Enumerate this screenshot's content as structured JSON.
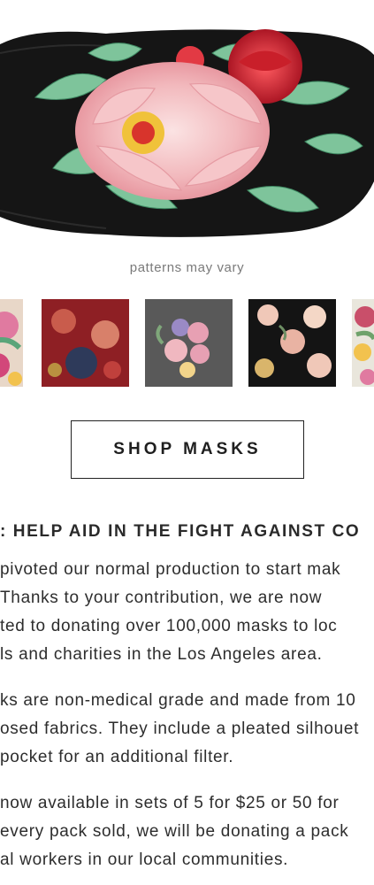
{
  "hero": {
    "image_name": "floral-peony-mask-image"
  },
  "caption": "patterns may vary",
  "pattern_swatches": [
    {
      "name": "pink-floral-swatch",
      "colors": [
        "#e8b0b8",
        "#5aa57a",
        "#d2477a"
      ]
    },
    {
      "name": "red-floral-swatch",
      "colors": [
        "#8e1f24",
        "#c0403c",
        "#2e3a5a"
      ]
    },
    {
      "name": "grey-bouquet-swatch",
      "colors": [
        "#595959",
        "#e7a0b3",
        "#9a8ac5"
      ]
    },
    {
      "name": "black-peony-swatch",
      "colors": [
        "#141414",
        "#f0c8b8",
        "#d9b56b"
      ]
    },
    {
      "name": "light-floral-swatch",
      "colors": [
        "#e9e6dc",
        "#c94f6a",
        "#6fa26b"
      ]
    }
  ],
  "shop_button": {
    "label": "SHOP MASKS"
  },
  "heading": ": HELP AID IN THE FIGHT AGAINST CO",
  "paragraphs": [
    [
      "pivoted our normal production to start mak",
      " Thanks to your contribution, we are now",
      "ted to donating over 100,000 masks to loc",
      "ls and charities in the Los Angeles area."
    ],
    [
      "ks are non-medical grade and made from 10",
      "osed fabrics. They include a pleated silhouet",
      " pocket for an additional filter."
    ],
    [
      " now available in sets of 5 for $25 or 50 for",
      " every pack sold, we will be donating a pack",
      "al workers in our local communities."
    ]
  ]
}
